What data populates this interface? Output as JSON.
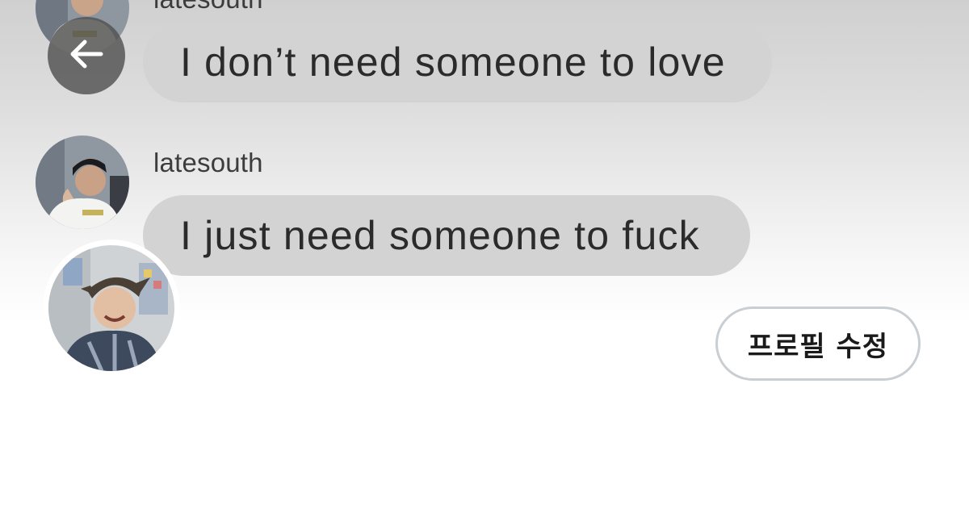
{
  "messages": [
    {
      "username": "latesouth",
      "text": "I don’t need someone to love"
    },
    {
      "username": "latesouth",
      "text": "I just need someone to fuck"
    }
  ],
  "header": {
    "back_icon": "arrow-left-icon"
  },
  "profile": {
    "edit_button_label": "프로필 수정"
  },
  "colors": {
    "bubble": "#d3d3d4",
    "button_border": "#c9ced3",
    "back_button": "#505050"
  }
}
